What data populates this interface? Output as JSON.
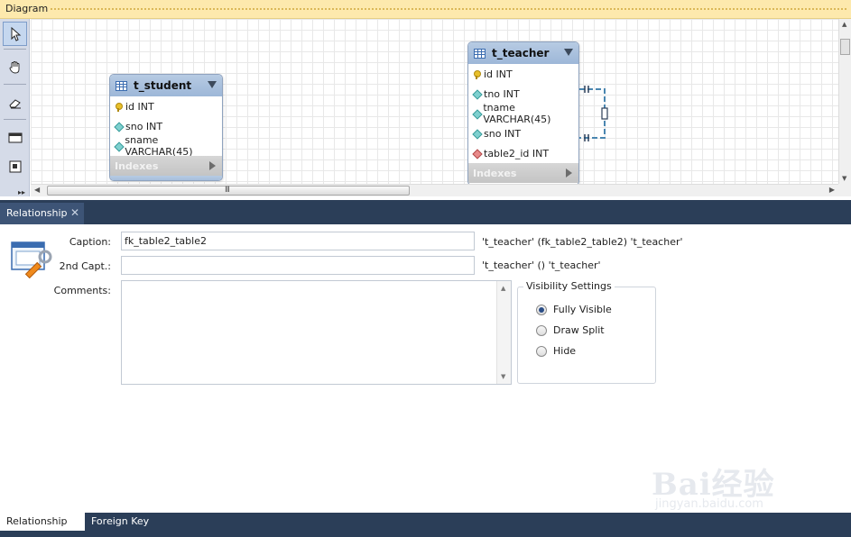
{
  "diagram": {
    "title": "Diagram"
  },
  "palette": {
    "tools": [
      "pointer-icon",
      "hand-icon",
      "eraser-icon",
      "layer-icon",
      "note-icon"
    ],
    "more": "▸▸"
  },
  "tables": {
    "student": {
      "name": "t_student",
      "columns": [
        {
          "icon": "primary-key-icon",
          "text": "id INT"
        },
        {
          "icon": "column-diamond-icon",
          "text": "sno INT"
        },
        {
          "icon": "column-diamond-icon",
          "text": "sname VARCHAR(45)"
        }
      ],
      "indexes_label": "Indexes"
    },
    "teacher": {
      "name": "t_teacher",
      "columns": [
        {
          "icon": "primary-key-icon",
          "text": "id INT"
        },
        {
          "icon": "column-diamond-icon",
          "text": "tno INT"
        },
        {
          "icon": "column-diamond-icon",
          "text": "tname VARCHAR(45)"
        },
        {
          "icon": "column-diamond-icon",
          "text": "sno INT"
        },
        {
          "icon": "foreign-key-icon",
          "text": "table2_id INT"
        }
      ],
      "indexes_label": "Indexes"
    }
  },
  "scroll": {
    "grip": "III"
  },
  "relationship_tab": {
    "label": "Relationship",
    "close": "✕"
  },
  "editor": {
    "caption_label": "Caption:",
    "caption_value": "fk_table2_table2",
    "caption_preview": "'t_teacher'  (fk_table2_table2)  't_teacher'",
    "caption2_label": "2nd Capt.:",
    "caption2_value": "",
    "caption2_preview": "'t_teacher' () 't_teacher'",
    "comments_label": "Comments:",
    "comments_value": ""
  },
  "visibility": {
    "title": "Visibility Settings",
    "options": [
      "Fully Visible",
      "Draw Split",
      "Hide"
    ],
    "selected": "Fully Visible"
  },
  "watermark": {
    "brand": "Bai经验",
    "sub": "jingyan.baidu.com"
  },
  "bottom_tabs": {
    "active": "Relationship",
    "inactive": "Foreign Key"
  },
  "colors": {
    "tab_bar": "#2b3e58",
    "diagram_header": "#fde9ad",
    "table_header": "#9db7d8"
  }
}
